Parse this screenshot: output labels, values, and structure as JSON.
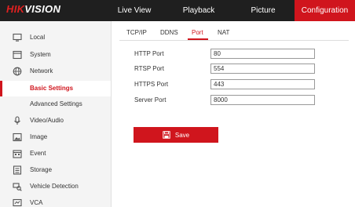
{
  "brand": {
    "hik": "HIK",
    "vision": "VISION"
  },
  "top_nav": {
    "live_view": "Live View",
    "playback": "Playback",
    "picture": "Picture",
    "configuration": "Configuration"
  },
  "sidebar": {
    "local": "Local",
    "system": "System",
    "network": "Network",
    "basic_settings": "Basic Settings",
    "advanced_settings": "Advanced Settings",
    "video_audio": "Video/Audio",
    "image": "Image",
    "event": "Event",
    "storage": "Storage",
    "vehicle_detection": "Vehicle Detection",
    "vca": "VCA"
  },
  "tabs": {
    "tcpip": "TCP/IP",
    "ddns": "DDNS",
    "port": "Port",
    "nat": "NAT",
    "active": "Port"
  },
  "form": {
    "http_label": "HTTP Port",
    "http_value": "80",
    "rtsp_label": "RTSP Port",
    "rtsp_value": "554",
    "https_label": "HTTPS Port",
    "https_value": "443",
    "server_label": "Server Port",
    "server_value": "8000"
  },
  "save_label": "Save",
  "colors": {
    "accent": "#d0151d",
    "topbar": "#1f1f1f",
    "sidebar": "#f4f4f4"
  }
}
